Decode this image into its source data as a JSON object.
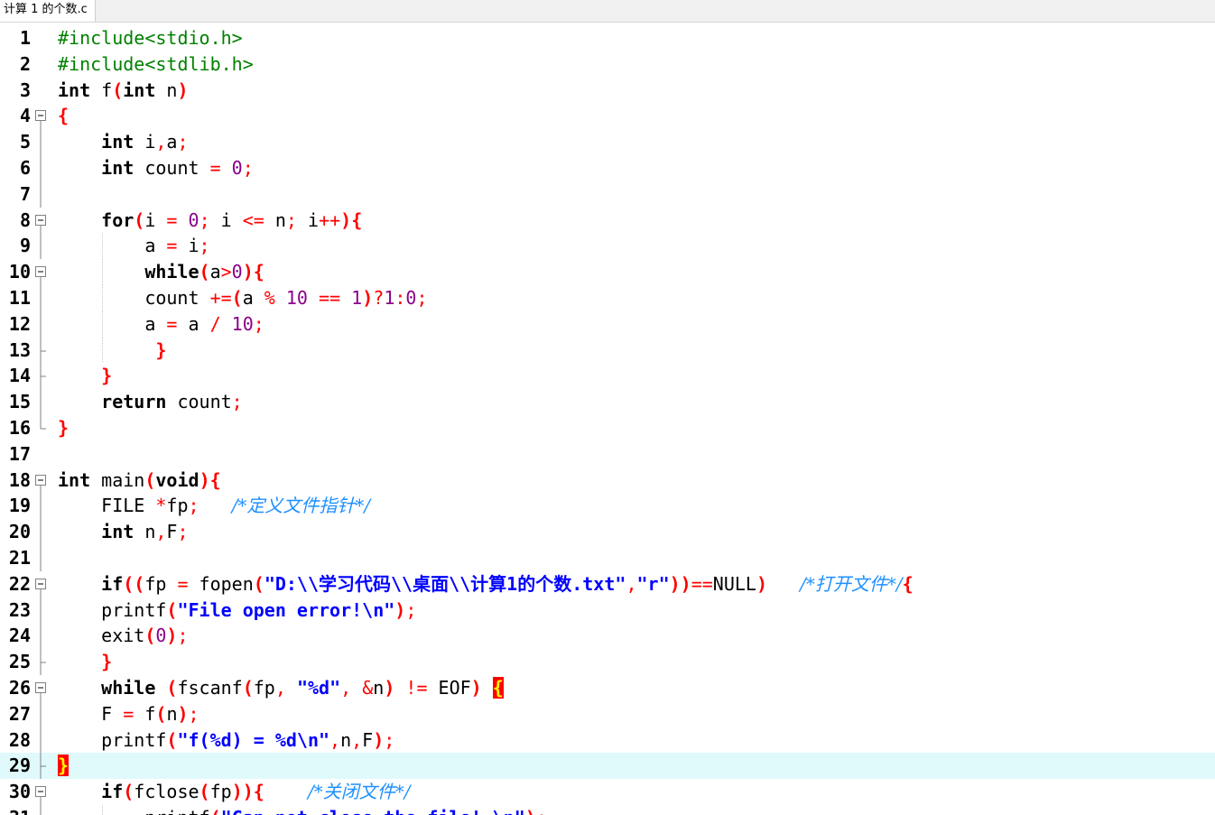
{
  "tab": {
    "label": "计算 1 的个数.c"
  },
  "editor": {
    "current_line": 29,
    "lines": [
      {
        "n": "1",
        "fold": "",
        "indent": 0,
        "tokens": [
          [
            "pre",
            "#include<stdio.h>"
          ]
        ]
      },
      {
        "n": "2",
        "fold": "",
        "indent": 0,
        "tokens": [
          [
            "pre",
            "#include<stdlib.h>"
          ]
        ]
      },
      {
        "n": "3",
        "fold": "",
        "indent": 0,
        "tokens": [
          [
            "kw",
            "int"
          ],
          [
            "id",
            " f"
          ],
          [
            "br",
            "("
          ],
          [
            "kw",
            "int"
          ],
          [
            "id",
            " n"
          ],
          [
            "br",
            ")"
          ]
        ]
      },
      {
        "n": "4",
        "fold": "open",
        "indent": 0,
        "tokens": [
          [
            "br",
            "{"
          ]
        ]
      },
      {
        "n": "5",
        "fold": "line",
        "indent": 1,
        "tokens": [
          [
            "kw",
            "int"
          ],
          [
            "id",
            " i"
          ],
          [
            "op",
            ","
          ],
          [
            "id",
            "a"
          ],
          [
            "op",
            ";"
          ]
        ]
      },
      {
        "n": "6",
        "fold": "line",
        "indent": 1,
        "tokens": [
          [
            "kw",
            "int"
          ],
          [
            "id",
            " count "
          ],
          [
            "op",
            "="
          ],
          [
            "id",
            " "
          ],
          [
            "num2",
            "0"
          ],
          [
            "op",
            ";"
          ]
        ]
      },
      {
        "n": "7",
        "fold": "line",
        "indent": 0,
        "tokens": []
      },
      {
        "n": "8",
        "fold": "open",
        "indent": 1,
        "tokens": [
          [
            "kw",
            "for"
          ],
          [
            "br",
            "("
          ],
          [
            "id",
            "i "
          ],
          [
            "op",
            "="
          ],
          [
            "id",
            " "
          ],
          [
            "num2",
            "0"
          ],
          [
            "op",
            ";"
          ],
          [
            "id",
            " i "
          ],
          [
            "op",
            "<="
          ],
          [
            "id",
            " n"
          ],
          [
            "op",
            ";"
          ],
          [
            "id",
            " i"
          ],
          [
            "op",
            "++"
          ],
          [
            "br",
            ")"
          ],
          [
            "br",
            "{"
          ]
        ]
      },
      {
        "n": "9",
        "fold": "line",
        "indent": 2,
        "tokens": [
          [
            "id",
            "a "
          ],
          [
            "op",
            "="
          ],
          [
            "id",
            " i"
          ],
          [
            "op",
            ";"
          ]
        ]
      },
      {
        "n": "10",
        "fold": "open",
        "indent": 2,
        "tokens": [
          [
            "kw",
            "while"
          ],
          [
            "br",
            "("
          ],
          [
            "id",
            "a"
          ],
          [
            "op",
            ">"
          ],
          [
            "num2",
            "0"
          ],
          [
            "br",
            ")"
          ],
          [
            "br",
            "{"
          ]
        ]
      },
      {
        "n": "11",
        "fold": "line",
        "indent": 2,
        "tokens": [
          [
            "id",
            "count "
          ],
          [
            "op",
            "+="
          ],
          [
            "br",
            "("
          ],
          [
            "id",
            "a "
          ],
          [
            "op",
            "%"
          ],
          [
            "id",
            " "
          ],
          [
            "num2",
            "10"
          ],
          [
            "id",
            " "
          ],
          [
            "op",
            "=="
          ],
          [
            "id",
            " "
          ],
          [
            "num2",
            "1"
          ],
          [
            "br",
            ")"
          ],
          [
            "op",
            "?"
          ],
          [
            "num2",
            "1"
          ],
          [
            "op",
            ":"
          ],
          [
            "num2",
            "0"
          ],
          [
            "op",
            ";"
          ]
        ]
      },
      {
        "n": "12",
        "fold": "line",
        "indent": 2,
        "tokens": [
          [
            "id",
            "a "
          ],
          [
            "op",
            "="
          ],
          [
            "id",
            " a "
          ],
          [
            "op",
            "/"
          ],
          [
            "id",
            " "
          ],
          [
            "num2",
            "10"
          ],
          [
            "op",
            ";"
          ]
        ]
      },
      {
        "n": "13",
        "fold": "end",
        "indent": 2,
        "tokens": [
          [
            "br",
            " }"
          ]
        ]
      },
      {
        "n": "14",
        "fold": "end",
        "indent": 1,
        "tokens": [
          [
            "br",
            "}"
          ]
        ]
      },
      {
        "n": "15",
        "fold": "line",
        "indent": 1,
        "tokens": [
          [
            "kw",
            "return"
          ],
          [
            "id",
            " count"
          ],
          [
            "op",
            ";"
          ]
        ]
      },
      {
        "n": "16",
        "fold": "close",
        "indent": 0,
        "tokens": [
          [
            "br",
            "}"
          ]
        ]
      },
      {
        "n": "17",
        "fold": "",
        "indent": 0,
        "tokens": []
      },
      {
        "n": "18",
        "fold": "open",
        "indent": 0,
        "tokens": [
          [
            "kw",
            "int"
          ],
          [
            "id",
            " main"
          ],
          [
            "br",
            "("
          ],
          [
            "kw",
            "void"
          ],
          [
            "br",
            ")"
          ],
          [
            "br",
            "{"
          ]
        ]
      },
      {
        "n": "19",
        "fold": "line",
        "indent": 1,
        "tokens": [
          [
            "id",
            "FILE "
          ],
          [
            "op",
            "*"
          ],
          [
            "id",
            "fp"
          ],
          [
            "op",
            ";"
          ],
          [
            "id",
            "   "
          ],
          [
            "cmt",
            "/*定义文件指针*/"
          ]
        ]
      },
      {
        "n": "20",
        "fold": "line",
        "indent": 1,
        "tokens": [
          [
            "kw",
            "int"
          ],
          [
            "id",
            " n"
          ],
          [
            "op",
            ","
          ],
          [
            "id",
            "F"
          ],
          [
            "op",
            ";"
          ]
        ]
      },
      {
        "n": "21",
        "fold": "line",
        "indent": 0,
        "tokens": []
      },
      {
        "n": "22",
        "fold": "open",
        "indent": 1,
        "tokens": [
          [
            "kw",
            "if"
          ],
          [
            "br",
            "(("
          ],
          [
            "id",
            "fp "
          ],
          [
            "op",
            "="
          ],
          [
            "id",
            " fopen"
          ],
          [
            "br",
            "("
          ],
          [
            "str",
            "\"D:\\\\学习代码\\\\桌面\\\\计算1的个数.txt\""
          ],
          [
            "op",
            ","
          ],
          [
            "str",
            "\"r\""
          ],
          [
            "br",
            "))"
          ],
          [
            "op",
            "=="
          ],
          [
            "id",
            "NULL"
          ],
          [
            "br",
            ")"
          ],
          [
            "id",
            "   "
          ],
          [
            "cmt",
            "/*打开文件*/"
          ],
          [
            "br",
            "{"
          ]
        ]
      },
      {
        "n": "23",
        "fold": "line",
        "indent": 1,
        "tokens": [
          [
            "id",
            "printf"
          ],
          [
            "br",
            "("
          ],
          [
            "str",
            "\"File open error!\\n\""
          ],
          [
            "br",
            ")"
          ],
          [
            "op",
            ";"
          ]
        ]
      },
      {
        "n": "24",
        "fold": "line",
        "indent": 1,
        "tokens": [
          [
            "id",
            "exit"
          ],
          [
            "br",
            "("
          ],
          [
            "num2",
            "0"
          ],
          [
            "br",
            ")"
          ],
          [
            "op",
            ";"
          ]
        ]
      },
      {
        "n": "25",
        "fold": "end",
        "indent": 1,
        "tokens": [
          [
            "br",
            "}"
          ]
        ]
      },
      {
        "n": "26",
        "fold": "open",
        "indent": 1,
        "tokens": [
          [
            "kw",
            "while"
          ],
          [
            "id",
            " "
          ],
          [
            "br",
            "("
          ],
          [
            "id",
            "fscanf"
          ],
          [
            "br",
            "("
          ],
          [
            "id",
            "fp"
          ],
          [
            "op",
            ","
          ],
          [
            "id",
            " "
          ],
          [
            "str",
            "\"%d\""
          ],
          [
            "op",
            ","
          ],
          [
            "id",
            " "
          ],
          [
            "op",
            "&"
          ],
          [
            "id",
            "n"
          ],
          [
            "br",
            ")"
          ],
          [
            "id",
            " "
          ],
          [
            "op",
            "!="
          ],
          [
            "id",
            " EOF"
          ],
          [
            "br",
            ")"
          ],
          [
            "id",
            " "
          ],
          [
            "hl",
            "{"
          ]
        ]
      },
      {
        "n": "27",
        "fold": "line",
        "indent": 1,
        "tokens": [
          [
            "id",
            "F "
          ],
          [
            "op",
            "="
          ],
          [
            "id",
            " f"
          ],
          [
            "br",
            "("
          ],
          [
            "id",
            "n"
          ],
          [
            "br",
            ")"
          ],
          [
            "op",
            ";"
          ]
        ]
      },
      {
        "n": "28",
        "fold": "line",
        "indent": 1,
        "tokens": [
          [
            "id",
            "printf"
          ],
          [
            "br",
            "("
          ],
          [
            "str",
            "\"f(%d) = %d\\n\""
          ],
          [
            "op",
            ","
          ],
          [
            "id",
            "n"
          ],
          [
            "op",
            ","
          ],
          [
            "id",
            "F"
          ],
          [
            "br",
            ")"
          ],
          [
            "op",
            ";"
          ]
        ]
      },
      {
        "n": "29",
        "fold": "end",
        "indent": 0,
        "tokens": [
          [
            "hl",
            "}"
          ]
        ]
      },
      {
        "n": "30",
        "fold": "open",
        "indent": 1,
        "tokens": [
          [
            "kw",
            "if"
          ],
          [
            "br",
            "("
          ],
          [
            "id",
            "fclose"
          ],
          [
            "br",
            "("
          ],
          [
            "id",
            "fp"
          ],
          [
            "br",
            "))"
          ],
          [
            "br",
            "{"
          ],
          [
            "id",
            "    "
          ],
          [
            "cmt",
            "/*关闭文件*/"
          ]
        ]
      },
      {
        "n": "31",
        "fold": "line",
        "indent": 2,
        "tokens": [
          [
            "id",
            "printf"
          ],
          [
            "br",
            "("
          ],
          [
            "str",
            "\"Can not close the file! \\n\""
          ],
          [
            "br",
            ")"
          ],
          [
            "op",
            ";"
          ]
        ]
      }
    ]
  }
}
